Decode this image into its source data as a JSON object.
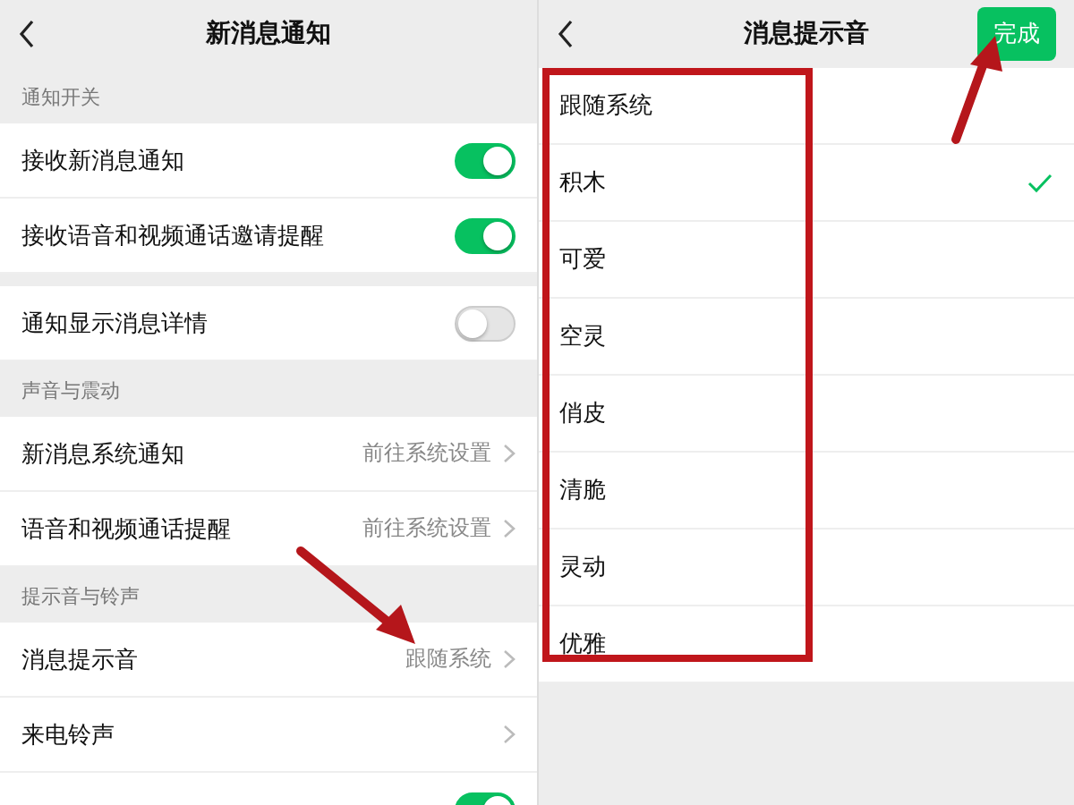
{
  "notification_settings": {
    "title": "新消息通知",
    "sections": [
      {
        "label": "通知开关",
        "rows": [
          {
            "kind": "toggle",
            "label": "接收新消息通知",
            "on": true
          },
          {
            "kind": "toggle",
            "label": "接收语音和视频通话邀请提醒",
            "on": true
          }
        ]
      },
      {
        "rows": [
          {
            "kind": "toggle",
            "label": "通知显示消息详情",
            "on": false
          }
        ]
      },
      {
        "label": "声音与震动",
        "rows": [
          {
            "kind": "link",
            "label": "新消息系统通知",
            "value": "前往系统设置"
          },
          {
            "kind": "link",
            "label": "语音和视频通话提醒",
            "value": "前往系统设置"
          }
        ]
      },
      {
        "label": "提示音与铃声",
        "rows": [
          {
            "kind": "link",
            "label": "消息提示音",
            "value": "跟随系统"
          },
          {
            "kind": "link",
            "label": "来电铃声"
          },
          {
            "kind": "toggle",
            "on": true
          }
        ]
      }
    ]
  },
  "sound_picker": {
    "title": "消息提示音",
    "done_button": "完成",
    "sounds": [
      {
        "label": "跟随系统",
        "selected": false
      },
      {
        "label": "积木",
        "selected": true
      },
      {
        "label": "可爱",
        "selected": false
      },
      {
        "label": "空灵",
        "selected": false
      },
      {
        "label": "俏皮",
        "selected": false
      },
      {
        "label": "清脆",
        "selected": false
      },
      {
        "label": "灵动",
        "selected": false
      },
      {
        "label": "优雅",
        "selected": false
      }
    ]
  }
}
